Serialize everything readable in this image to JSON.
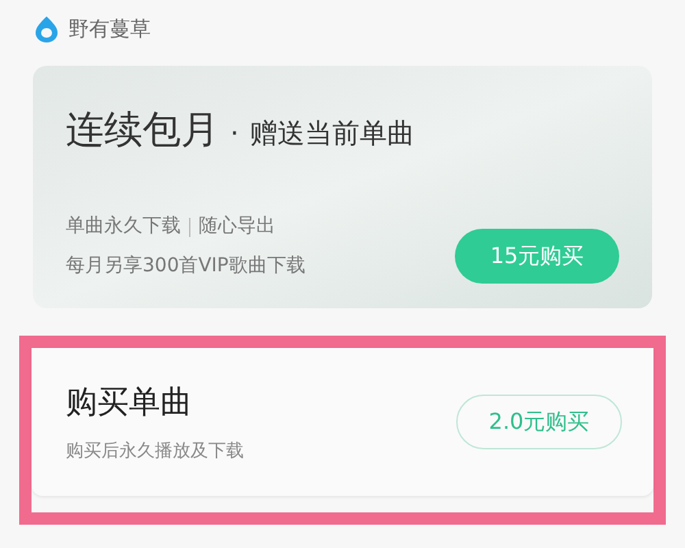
{
  "header": {
    "title": "野有蔓草"
  },
  "monthly_plan": {
    "title": "连续包月",
    "separator": "·",
    "subtitle": "赠送当前单曲",
    "features": [
      "单曲永久下载",
      "随心导出"
    ],
    "note": "每月另享300首VIP歌曲下载",
    "button": "15元购买"
  },
  "single_purchase": {
    "title": "购买单曲",
    "description": "购买后永久播放及下载",
    "button": "2.0元购买",
    "highlighted": true
  }
}
